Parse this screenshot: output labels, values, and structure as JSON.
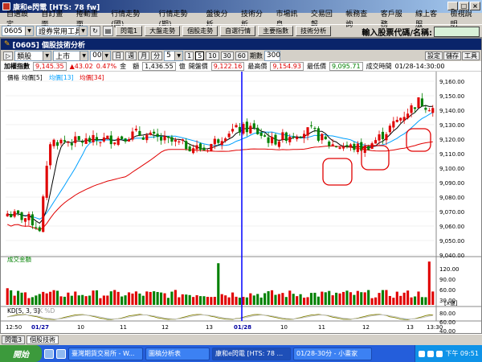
{
  "window": {
    "title": "康和e閃電 [HTS: 78 fw]"
  },
  "menu": [
    "自選設定",
    "自訂畫面",
    "捲動畫面",
    "行情走勢(國)",
    "行情走勢(期)",
    "盤後分析",
    "技術分析",
    "市場訊息",
    "交易回報",
    "帳務查詢",
    "客戶服務",
    "線上客服",
    "檢視說明"
  ],
  "toolbar": {
    "code": "0605",
    "tool_combo": "證券常用工具",
    "buttons": [
      "閃電1",
      "大盤走勢",
      "個股走勢",
      "自選行情",
      "主要指數",
      "技術分析"
    ],
    "search_label": "輸入股票代碼/名稱:"
  },
  "chart_window": {
    "title": "[0605] 個股技術分析",
    "stock": "類股",
    "market": "上市",
    "period_num": "001",
    "periods": [
      "日",
      "週",
      "月",
      "分"
    ],
    "interval": "5",
    "bar_opts": [
      "1",
      "5",
      "10",
      "30",
      "60"
    ],
    "count_label": "期數",
    "count": "300",
    "right_buttons": [
      "設定",
      "儲存",
      "工具"
    ]
  },
  "info": {
    "name": "加權指數",
    "last": "9,145.35",
    "change": "▲43.02",
    "pct": "0.47%",
    "amt_label": "金　額",
    "amt": "1,436.55",
    "amt_unit": "億",
    "open_label": "開盤價",
    "open": "9,122.16",
    "high_label": "最高價",
    "high": "9,154.93",
    "low_label": "最低價",
    "low": "9,095.71",
    "time_label": "成交時間",
    "time": "01/28-14:30:00"
  },
  "price_panel": {
    "legend": [
      "價格",
      "均價[5]",
      "均價[13]",
      "均價[34]"
    ],
    "yticks": [
      "9,160.00",
      "9,150.00",
      "9,140.00",
      "9,130.00",
      "9,120.00",
      "9,110.00",
      "9,100.00",
      "9,090.00",
      "9,080.00",
      "9,070.00",
      "9,060.00",
      "9,050.00",
      "9,040.00"
    ]
  },
  "volume_panel": {
    "title": "成交金額",
    "yticks": [
      "120.00",
      "90.00",
      "60.00",
      "30.00"
    ],
    "unit": "[x億]"
  },
  "kd_panel": {
    "title": "KD[5, 3, 3]",
    "legend": "%K %D",
    "yticks": [
      "80.00",
      "60.00",
      "40.00",
      "20.00"
    ]
  },
  "xaxis": [
    "12:50",
    "01/27",
    "10",
    "11",
    "12",
    "13",
    "01/28",
    "10",
    "11",
    "12",
    "13",
    "13:30"
  ],
  "chart_data": {
    "type": "candlestick",
    "y_range": [
      9035,
      9165
    ],
    "volume_range": [
      0,
      140
    ],
    "kd_range": [
      0,
      100
    ],
    "colors": {
      "up": "#e00000",
      "down": "#008000",
      "ma5": "#000000",
      "ma13": "#00a0ff",
      "ma34": "#e00000"
    }
  },
  "status_tabs": [
    "閃電3",
    "個股技術"
  ],
  "taskbar": {
    "start": "開始",
    "tasks": [
      "臺灣期貨交易所 - W...",
      "圖稿分析表",
      "康和e閃電 [HTS: 78 ...",
      "01/28-30分 - 小畫家"
    ],
    "clock": "下午 09:51"
  }
}
